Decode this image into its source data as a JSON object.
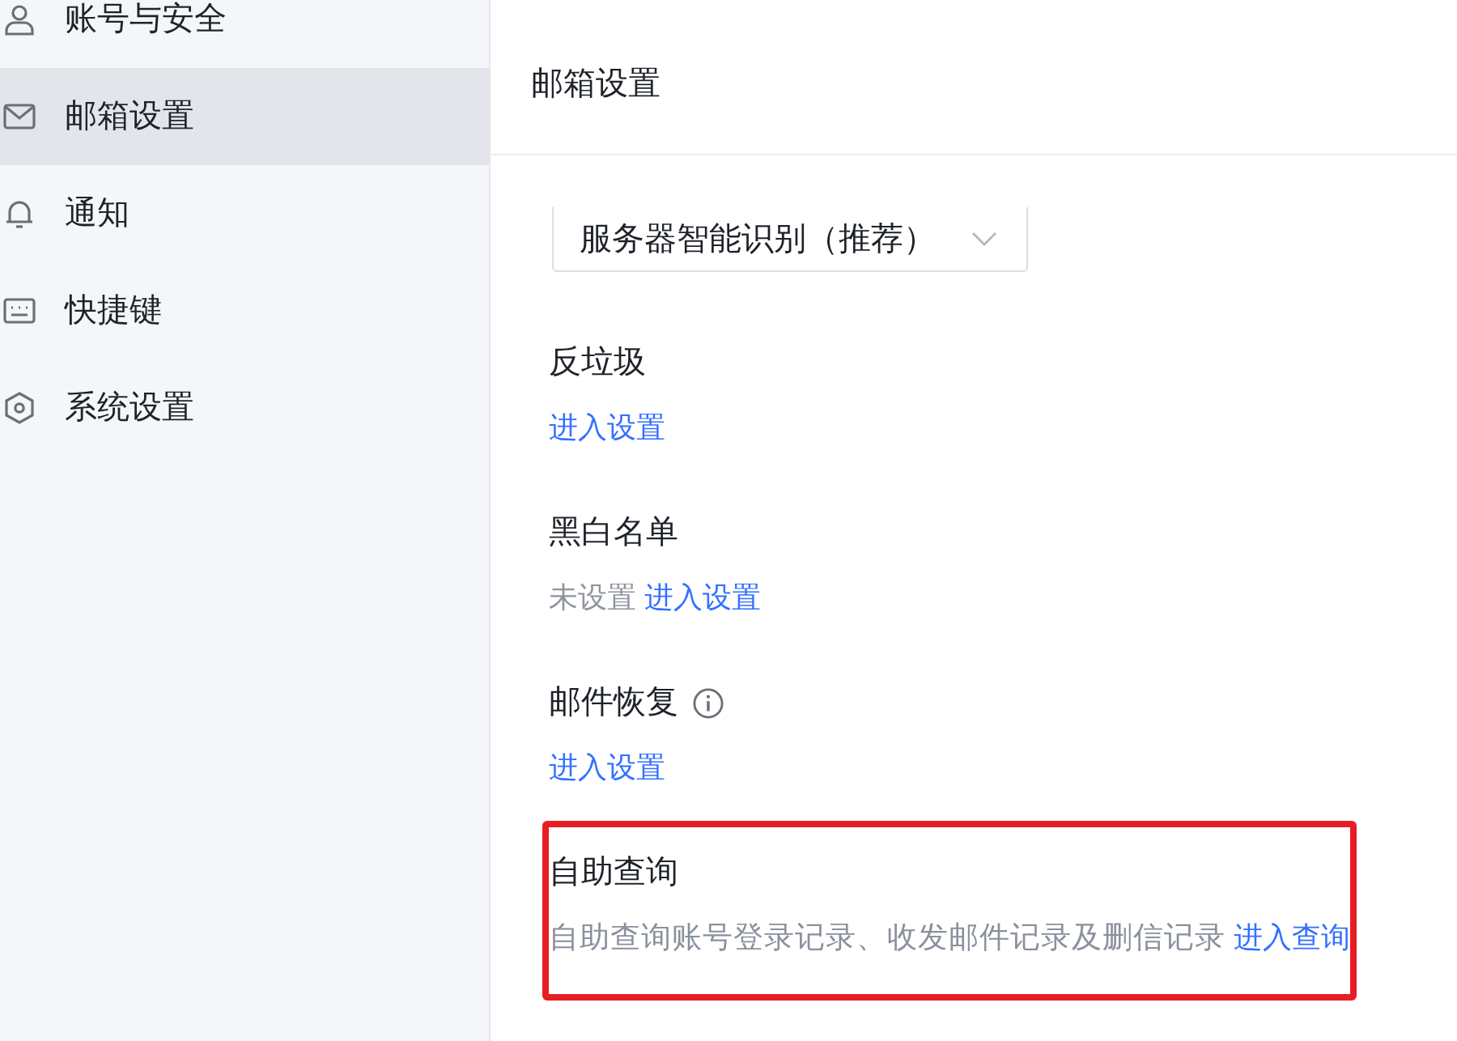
{
  "sidebar": {
    "items": [
      {
        "label": "账号与安全",
        "selected": false
      },
      {
        "label": "邮箱设置",
        "selected": true
      },
      {
        "label": "通知",
        "selected": false
      },
      {
        "label": "快捷键",
        "selected": false
      },
      {
        "label": "系统设置",
        "selected": false
      }
    ]
  },
  "header": {
    "title": "邮箱设置"
  },
  "server_dropdown": {
    "value": "服务器智能识别（推荐）"
  },
  "sections": [
    {
      "title": "反垃圾",
      "info": false,
      "link": "进入设置",
      "highlighted": false
    },
    {
      "title": "黑白名单",
      "info": false,
      "status": "未设置",
      "link": "进入设置",
      "highlighted": false
    },
    {
      "title": "邮件恢复",
      "info": true,
      "link": "进入设置",
      "highlighted": false
    },
    {
      "title": "自助查询",
      "info": false,
      "description": "自助查询账号登录记录、收发邮件记录及删信记录",
      "link": "进入查询",
      "highlighted": true
    }
  ]
}
